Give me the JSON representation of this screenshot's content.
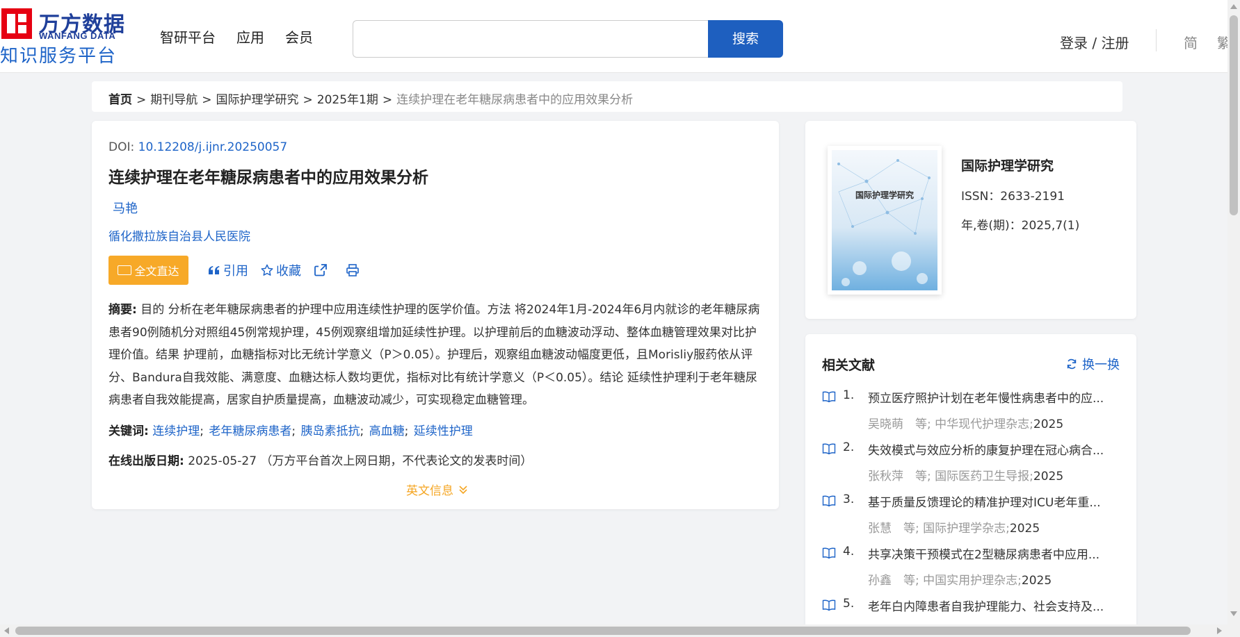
{
  "brand": {
    "logo_cn": "万方数据",
    "logo_en": "WANFANG DATA",
    "logo_sub": "知识服务平台"
  },
  "nav": [
    "智研平台",
    "应用",
    "会员"
  ],
  "search": {
    "placeholder": "",
    "button_label": "搜索"
  },
  "user": {
    "login_label": "登录 / 注册",
    "lang_simplified": "简",
    "lang_traditional": "繁"
  },
  "breadcrumb": {
    "home": "首页",
    "items": [
      "期刊导航",
      "国际护理学研究",
      "2025年1期"
    ],
    "current": "连续护理在老年糖尿病患者中的应用效果分析",
    "separator": ">"
  },
  "article": {
    "doi_label": "DOI: ",
    "doi": "10.12208/j.ijnr.20250057",
    "title": "连续护理在老年糖尿病患者中的应用效果分析",
    "author": "马艳",
    "organization": "循化撒拉族自治县人民医院",
    "actions": {
      "full_text": "全文直达",
      "cite": "引用",
      "collect": "收藏"
    },
    "abstract_label": "摘要:",
    "abstract": "目的 分析在老年糖尿病患者的护理中应用连续性护理的医学价值。方法 将2024年1月-2024年6月内就诊的老年糖尿病患者90例随机分对照组45例常规护理，45例观察组增加延续性护理。以护理前后的血糖波动浮动、整体血糖管理效果对比护理价值。结果 护理前，血糖指标对比无统计学意义（P＞0.05）。护理后，观察组血糖波动幅度更低，且Morisliy服药依从评分、Bandura自我效能、满意度、血糖达标人数均更优，指标对比有统计学意义（P＜0.05）。结论 延续性护理利于老年糖尿病患者自我效能提高，居家自护质量提高，血糖波动减少，可实现稳定血糖管理。",
    "keywords_label": "关键词:",
    "keywords": [
      "连续护理",
      "老年糖尿病患者",
      "胰岛素抵抗",
      "高血糖",
      "延续性护理"
    ],
    "keyword_sep": ";",
    "pubdate_label": "在线出版日期:",
    "pubdate": "2025-05-27",
    "pubdate_note": "（万方平台首次上网日期，不代表论文的发表时间）",
    "english_info": "英文信息"
  },
  "journal": {
    "cover_title": "国际护理学研究",
    "name": "国际护理学研究",
    "issn": "ISSN：2633-2191",
    "volume": "年,卷(期)：2025,7(1)"
  },
  "related": {
    "heading": "相关文献",
    "refresh_label": "换一换",
    "items": [
      {
        "num": "1.",
        "title": "预立医疗照护计划在老年慢性病患者中的应...",
        "author": "吴晓萌　等;",
        "source": "中华现代护理杂志;",
        "year": "2025"
      },
      {
        "num": "2.",
        "title": "失效模式与效应分析的康复护理在冠心病合...",
        "author": "张秋萍　等;",
        "source": "国际医药卫生导报;",
        "year": "2025"
      },
      {
        "num": "3.",
        "title": "基于质量反馈理论的精准护理对ICU老年重...",
        "author": "张慧　等;",
        "source": "国际护理学杂志;",
        "year": "2025"
      },
      {
        "num": "4.",
        "title": "共享决策干预模式在2型糖尿病患者中应用...",
        "author": "孙鑫　等;",
        "source": "中国实用护理杂志;",
        "year": "2025"
      },
      {
        "num": "5.",
        "title": "老年白内障患者自我护理能力、社会支持及...",
        "author": "",
        "source": "",
        "year": ""
      }
    ]
  },
  "colors": {
    "brand_red": "#e60012",
    "brand_blue": "#1f3f9a",
    "link_blue": "#1e64c8",
    "button_blue": "#1e5fbf",
    "accent_orange": "#f7a928"
  }
}
